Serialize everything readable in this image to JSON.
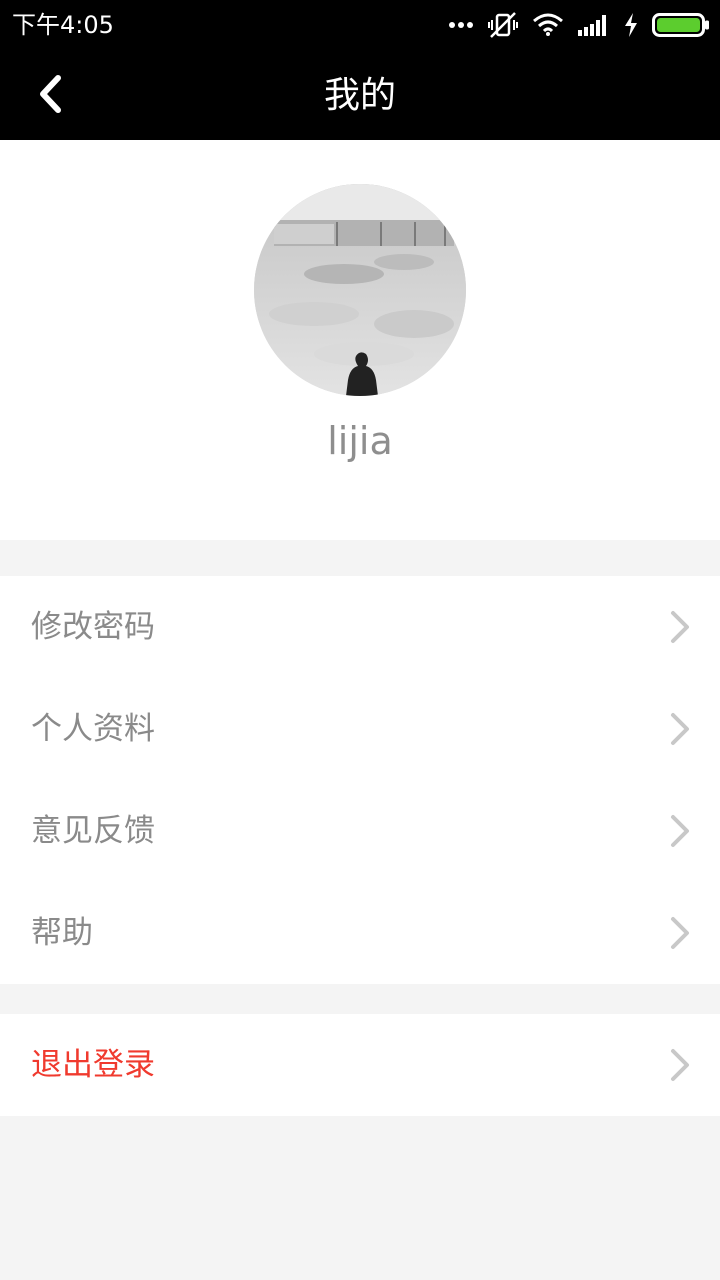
{
  "status_bar": {
    "time": "下午4:05",
    "icons": [
      "more-dots-icon",
      "vibrate-off-icon",
      "wifi-icon",
      "signal-icon",
      "charging-bolt-icon",
      "battery-icon"
    ],
    "battery_level": 1.0,
    "battery_color": "#5ccd2e"
  },
  "nav": {
    "title": "我的",
    "back_icon": "chevron-left-icon"
  },
  "profile": {
    "username": "lijia"
  },
  "menu": {
    "items": [
      {
        "label": "修改密码"
      },
      {
        "label": "个人资料"
      },
      {
        "label": "意见反馈"
      },
      {
        "label": "帮助"
      }
    ],
    "logout": {
      "label": "退出登录",
      "color": "#f03a2e"
    }
  }
}
